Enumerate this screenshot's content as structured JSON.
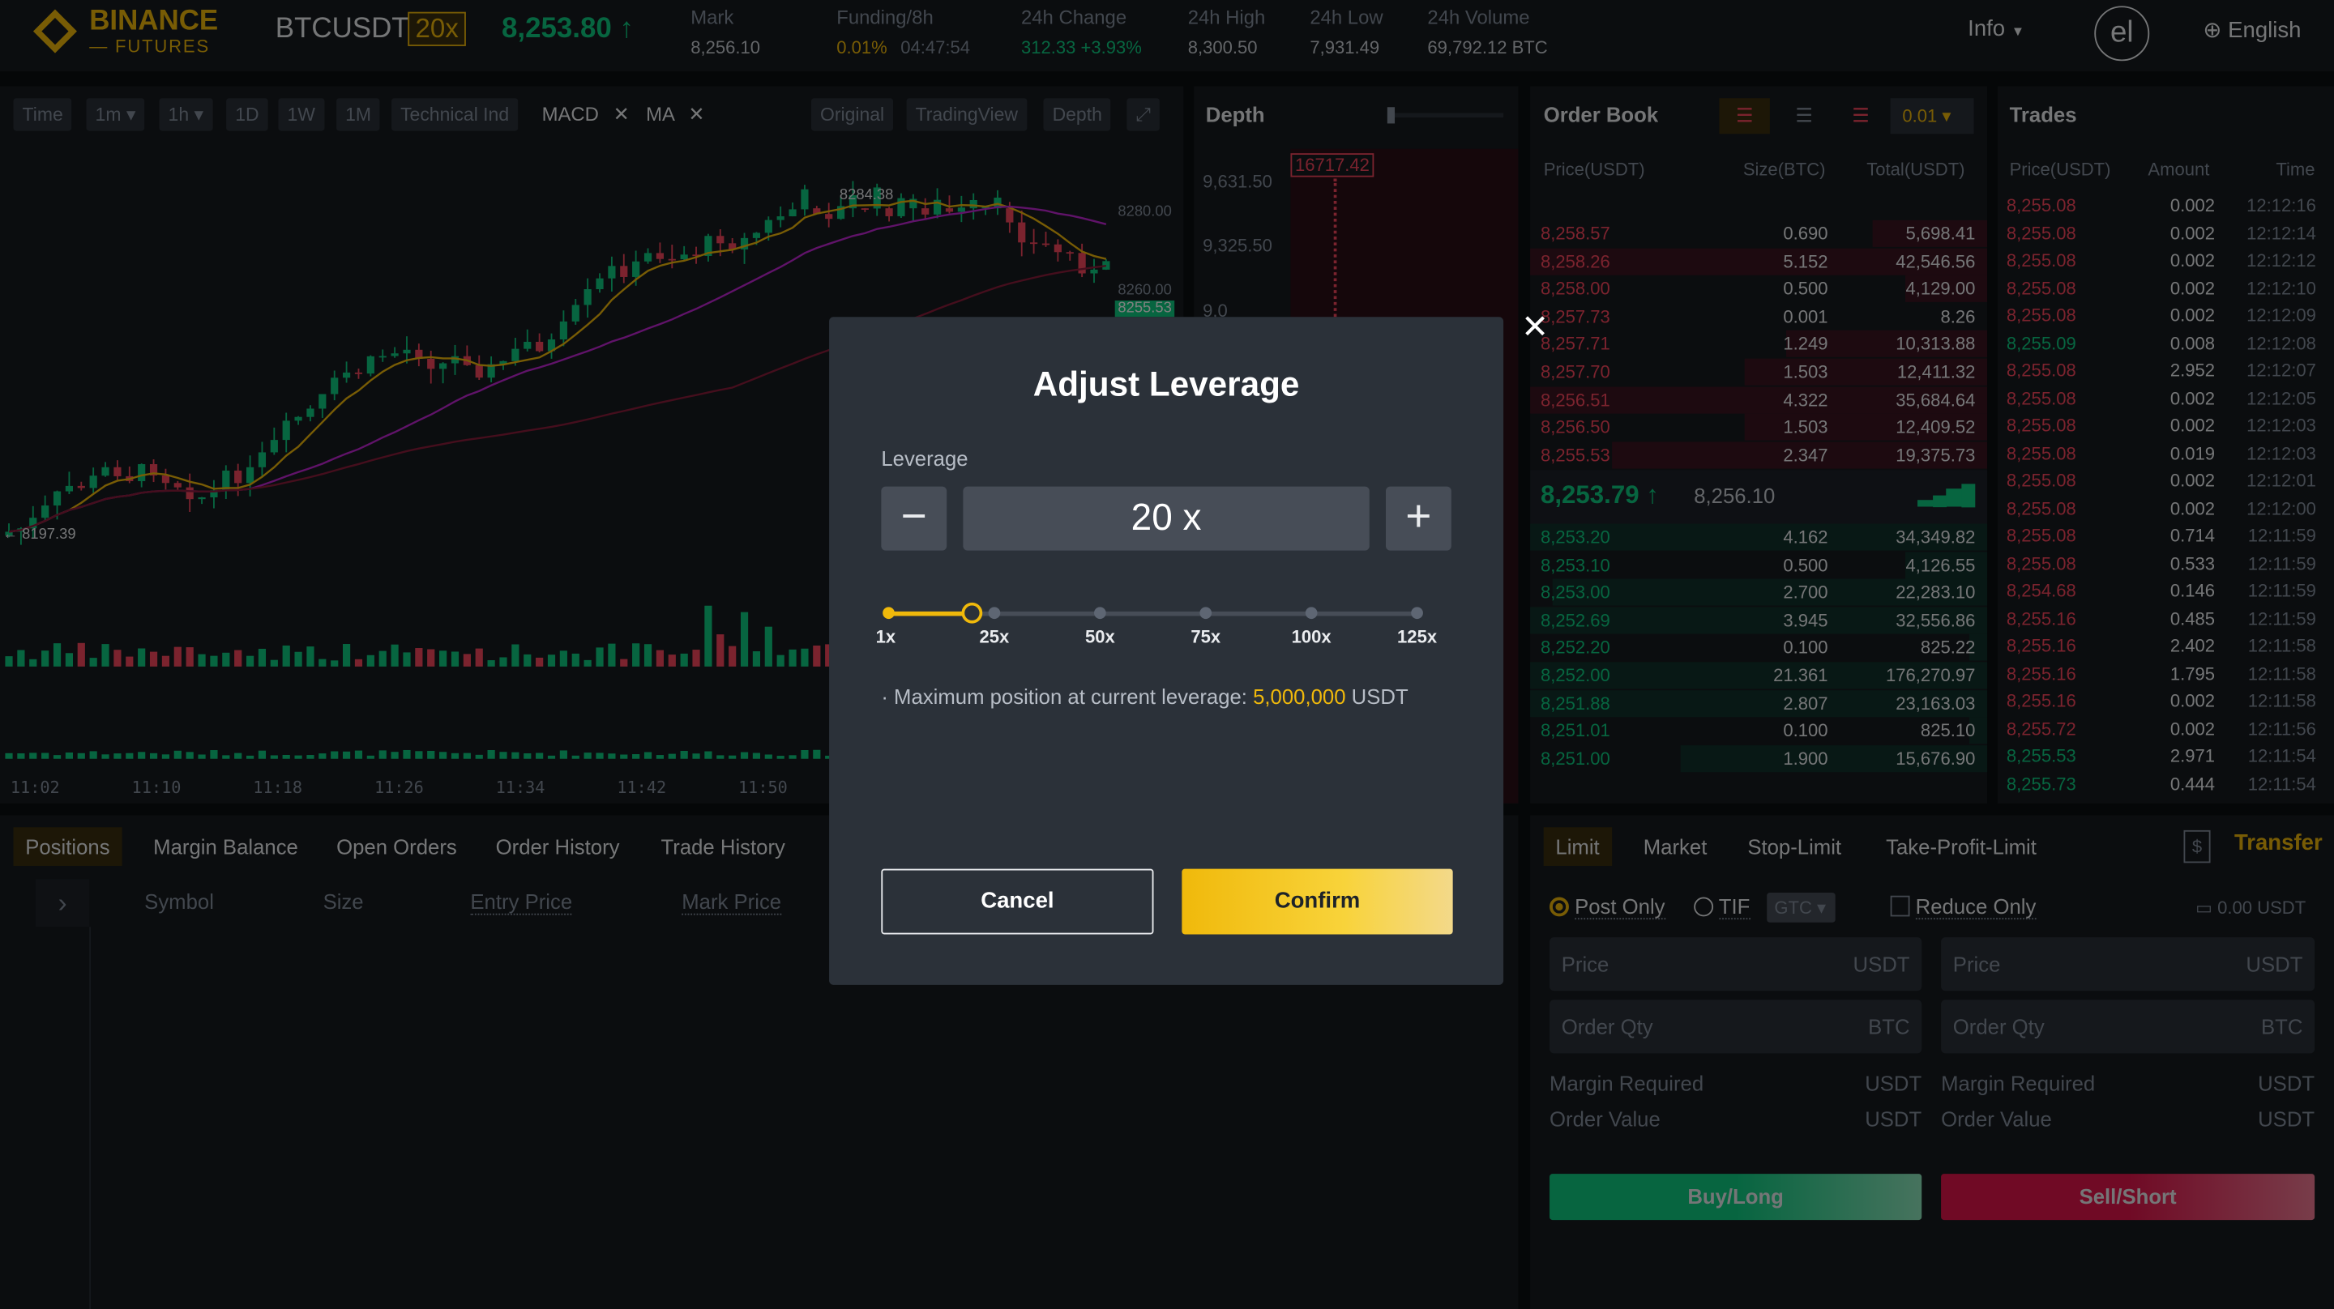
{
  "header": {
    "brand_top": "BINANCE",
    "brand_bottom": "FUTURES",
    "symbol": "BTCUSDT",
    "leverage_badge": "20x",
    "last_price": "8,253.80",
    "mark_label": "Mark",
    "mark_value": "8,256.10",
    "funding_label": "Funding/8h",
    "funding_rate": "0.01%",
    "funding_countdown": "04:47:54",
    "change_label": "24h Change",
    "change_value": "312.33 +3.93%",
    "high_label": "24h High",
    "high_value": "8,300.50",
    "low_label": "24h Low",
    "low_value": "7,931.49",
    "volume_label": "24h Volume",
    "volume_value": "69,792.12 BTC",
    "info": "Info",
    "avatar": "el",
    "language": "English"
  },
  "chart": {
    "toolbar": [
      "Time",
      "1m",
      "1h",
      "1D",
      "1W",
      "1M",
      "Technical Ind"
    ],
    "indicators": [
      "MACD",
      "MA"
    ],
    "views": [
      "Original",
      "TradingView",
      "Depth"
    ],
    "price_high_label": "8284.38",
    "price_low_label": "8197.39",
    "axis_prices": [
      "8280.00",
      "8260.00",
      "8255.53"
    ],
    "time_labels": [
      "11:02",
      "11:10",
      "11:18",
      "11:26",
      "11:34",
      "11:42",
      "11:50"
    ]
  },
  "depth": {
    "title": "Depth",
    "axis": [
      "9,631.50",
      "9,325.50",
      "9,0"
    ],
    "tooltip": "16717.42"
  },
  "order_book": {
    "title": "Order Book",
    "precision": "0.01",
    "headers": [
      "Price(USDT)",
      "Size(BTC)",
      "Total(USDT)"
    ],
    "asks": [
      [
        "8,258.57",
        "0.690",
        "5,698.41",
        0.25
      ],
      [
        "8,258.26",
        "5.152",
        "42,546.56",
        1
      ],
      [
        "8,258.00",
        "0.500",
        "4,129.00",
        0.18
      ],
      [
        "8,257.73",
        "0.001",
        "8.26",
        0
      ],
      [
        "8,257.71",
        "1.249",
        "10,313.88",
        0.44
      ],
      [
        "8,257.70",
        "1.503",
        "12,411.32",
        0.53
      ],
      [
        "8,256.51",
        "4.322",
        "35,684.64",
        1
      ],
      [
        "8,256.50",
        "1.503",
        "12,409.52",
        0.53
      ],
      [
        "8,255.53",
        "2.347",
        "19,375.73",
        0.82
      ]
    ],
    "mid_price": "8,253.79",
    "mid_mark": "8,256.10",
    "bids": [
      [
        "8,253.20",
        "4.162",
        "34,349.82",
        1
      ],
      [
        "8,253.10",
        "0.500",
        "4,126.55",
        0.18
      ],
      [
        "8,253.00",
        "2.700",
        "22,283.10",
        0.95
      ],
      [
        "8,252.69",
        "3.945",
        "32,556.86",
        1
      ],
      [
        "8,252.20",
        "0.100",
        "825.22",
        0.04
      ],
      [
        "8,252.00",
        "21.361",
        "176,270.97",
        1
      ],
      [
        "8,251.88",
        "2.807",
        "23,163.03",
        1
      ],
      [
        "8,251.01",
        "0.100",
        "825.10",
        0.04
      ],
      [
        "8,251.00",
        "1.900",
        "15,676.90",
        0.67
      ]
    ]
  },
  "trades": {
    "title": "Trades",
    "headers": [
      "Price(USDT)",
      "Amount",
      "Time"
    ],
    "rows": [
      [
        "8,255.08",
        "0.002",
        "12:12:16",
        "sell"
      ],
      [
        "8,255.08",
        "0.002",
        "12:12:14",
        "sell"
      ],
      [
        "8,255.08",
        "0.002",
        "12:12:12",
        "sell"
      ],
      [
        "8,255.08",
        "0.002",
        "12:12:10",
        "sell"
      ],
      [
        "8,255.08",
        "0.002",
        "12:12:09",
        "sell"
      ],
      [
        "8,255.09",
        "0.008",
        "12:12:08",
        "buy"
      ],
      [
        "8,255.08",
        "2.952",
        "12:12:07",
        "sell"
      ],
      [
        "8,255.08",
        "0.002",
        "12:12:05",
        "sell"
      ],
      [
        "8,255.08",
        "0.002",
        "12:12:03",
        "sell"
      ],
      [
        "8,255.08",
        "0.019",
        "12:12:03",
        "sell"
      ],
      [
        "8,255.08",
        "0.002",
        "12:12:01",
        "sell"
      ],
      [
        "8,255.08",
        "0.002",
        "12:12:00",
        "sell"
      ],
      [
        "8,255.08",
        "0.714",
        "12:11:59",
        "sell"
      ],
      [
        "8,255.08",
        "0.533",
        "12:11:59",
        "sell"
      ],
      [
        "8,254.68",
        "0.146",
        "12:11:59",
        "sell"
      ],
      [
        "8,255.16",
        "0.485",
        "12:11:59",
        "sell"
      ],
      [
        "8,255.16",
        "2.402",
        "12:11:58",
        "sell"
      ],
      [
        "8,255.16",
        "1.795",
        "12:11:58",
        "sell"
      ],
      [
        "8,255.16",
        "0.002",
        "12:11:58",
        "sell"
      ],
      [
        "8,255.72",
        "0.002",
        "12:11:56",
        "sell"
      ],
      [
        "8,255.53",
        "2.971",
        "12:11:54",
        "buy"
      ],
      [
        "8,255.73",
        "0.444",
        "12:11:54",
        "buy"
      ]
    ]
  },
  "positions": {
    "tabs": [
      "Positions",
      "Margin Balance",
      "Open Orders",
      "Order History",
      "Trade History"
    ],
    "columns": [
      "Symbol",
      "Size",
      "Entry Price",
      "Mark Price"
    ]
  },
  "order_form": {
    "tabs": [
      "Limit",
      "Market",
      "Stop-Limit",
      "Take-Profit-Limit"
    ],
    "transfer": "Transfer",
    "post_only": "Post Only",
    "tif": "TIF",
    "tif_value": "GTC",
    "reduce_only": "Reduce Only",
    "balance": "0.00 USDT",
    "price_placeholder": "Price",
    "price_unit": "USDT",
    "qty_placeholder": "Order Qty",
    "qty_unit": "BTC",
    "margin_label": "Margin Required",
    "margin_unit": "USDT",
    "value_label": "Order Value",
    "value_unit": "USDT",
    "buy": "Buy/Long",
    "sell": "Sell/Short"
  },
  "modal": {
    "title": "Adjust Leverage",
    "leverage_label": "Leverage",
    "leverage_value": "20 x",
    "slider_marks": [
      "1x",
      "25x",
      "50x",
      "75x",
      "100x",
      "125x"
    ],
    "slider_value": 20,
    "slider_max": 125,
    "max_position_prefix": "· Maximum position at current leverage: ",
    "max_position_value": "5,000,000",
    "max_position_unit": " USDT",
    "cancel": "Cancel",
    "confirm": "Confirm"
  },
  "colors": {
    "accent": "#f0b90b",
    "buy": "#0ecb81",
    "sell": "#f6465d"
  }
}
